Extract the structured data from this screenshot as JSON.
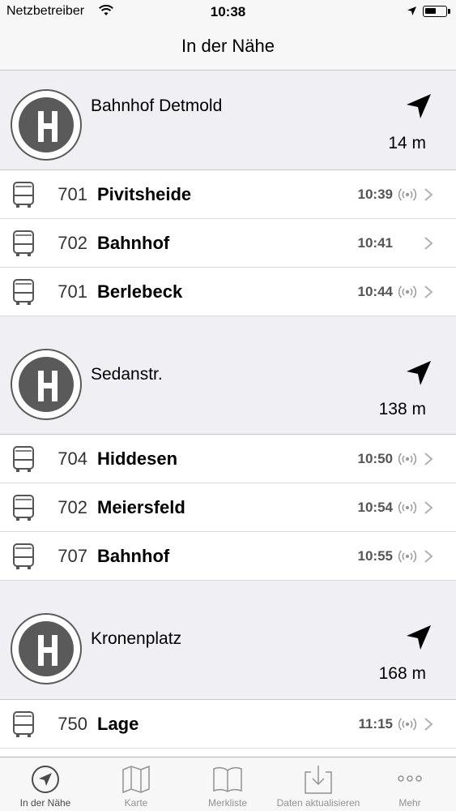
{
  "status_bar": {
    "carrier": "Netzbetreiber",
    "time": "10:38"
  },
  "nav": {
    "title": "In der Nähe"
  },
  "stops": [
    {
      "name": "Bahnhof Detmold",
      "distance": "14 m",
      "departures": [
        {
          "line": "701",
          "destination": "Pivitsheide",
          "time": "10:39",
          "realtime": true
        },
        {
          "line": "702",
          "destination": "Bahnhof",
          "time": "10:41",
          "realtime": false
        },
        {
          "line": "701",
          "destination": "Berlebeck",
          "time": "10:44",
          "realtime": true
        }
      ]
    },
    {
      "name": "Sedanstr.",
      "distance": "138 m",
      "departures": [
        {
          "line": "704",
          "destination": "Hiddesen",
          "time": "10:50",
          "realtime": true
        },
        {
          "line": "702",
          "destination": "Meiersfeld",
          "time": "10:54",
          "realtime": true
        },
        {
          "line": "707",
          "destination": "Bahnhof",
          "time": "10:55",
          "realtime": true
        }
      ]
    },
    {
      "name": "Kronenplatz",
      "distance": "168 m",
      "departures": [
        {
          "line": "750",
          "destination": "Lage",
          "time": "11:15",
          "realtime": true
        }
      ]
    }
  ],
  "tab_bar": {
    "tabs": [
      {
        "label": "In der Nähe",
        "icon": "location-arrow-icon",
        "active": true
      },
      {
        "label": "Karte",
        "icon": "map-icon",
        "active": false
      },
      {
        "label": "Merkliste",
        "icon": "book-icon",
        "active": false
      },
      {
        "label": "Daten aktualisieren",
        "icon": "download-icon",
        "active": false
      },
      {
        "label": "Mehr",
        "icon": "more-dots-icon",
        "active": false
      }
    ]
  },
  "colors": {
    "header_bg": "#efeff4",
    "stop_icon": "#5a5a5a",
    "tab_inactive": "#929292"
  }
}
